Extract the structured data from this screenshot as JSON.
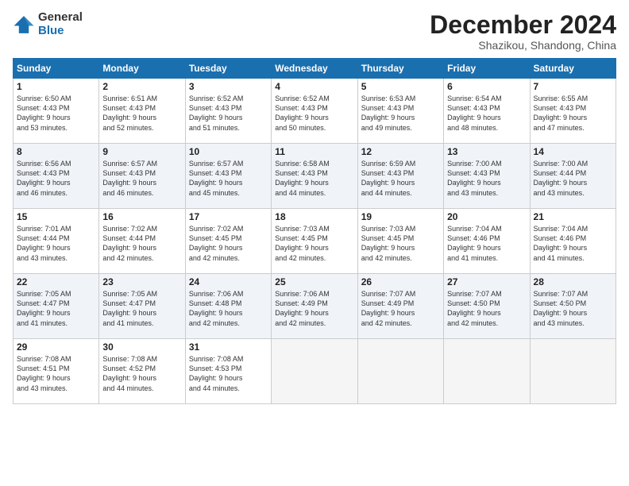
{
  "header": {
    "logo_general": "General",
    "logo_blue": "Blue",
    "month_title": "December 2024",
    "subtitle": "Shazikou, Shandong, China"
  },
  "weekdays": [
    "Sunday",
    "Monday",
    "Tuesday",
    "Wednesday",
    "Thursday",
    "Friday",
    "Saturday"
  ],
  "weeks": [
    [
      {
        "day": 1,
        "sunrise": "6:50 AM",
        "sunset": "4:43 PM",
        "daylight": "9 hours and 53 minutes."
      },
      {
        "day": 2,
        "sunrise": "6:51 AM",
        "sunset": "4:43 PM",
        "daylight": "9 hours and 52 minutes."
      },
      {
        "day": 3,
        "sunrise": "6:52 AM",
        "sunset": "4:43 PM",
        "daylight": "9 hours and 51 minutes."
      },
      {
        "day": 4,
        "sunrise": "6:52 AM",
        "sunset": "4:43 PM",
        "daylight": "9 hours and 50 minutes."
      },
      {
        "day": 5,
        "sunrise": "6:53 AM",
        "sunset": "4:43 PM",
        "daylight": "9 hours and 49 minutes."
      },
      {
        "day": 6,
        "sunrise": "6:54 AM",
        "sunset": "4:43 PM",
        "daylight": "9 hours and 48 minutes."
      },
      {
        "day": 7,
        "sunrise": "6:55 AM",
        "sunset": "4:43 PM",
        "daylight": "9 hours and 47 minutes."
      }
    ],
    [
      {
        "day": 8,
        "sunrise": "6:56 AM",
        "sunset": "4:43 PM",
        "daylight": "9 hours and 46 minutes."
      },
      {
        "day": 9,
        "sunrise": "6:57 AM",
        "sunset": "4:43 PM",
        "daylight": "9 hours and 46 minutes."
      },
      {
        "day": 10,
        "sunrise": "6:57 AM",
        "sunset": "4:43 PM",
        "daylight": "9 hours and 45 minutes."
      },
      {
        "day": 11,
        "sunrise": "6:58 AM",
        "sunset": "4:43 PM",
        "daylight": "9 hours and 44 minutes."
      },
      {
        "day": 12,
        "sunrise": "6:59 AM",
        "sunset": "4:43 PM",
        "daylight": "9 hours and 44 minutes."
      },
      {
        "day": 13,
        "sunrise": "7:00 AM",
        "sunset": "4:43 PM",
        "daylight": "9 hours and 43 minutes."
      },
      {
        "day": 14,
        "sunrise": "7:00 AM",
        "sunset": "4:44 PM",
        "daylight": "9 hours and 43 minutes."
      }
    ],
    [
      {
        "day": 15,
        "sunrise": "7:01 AM",
        "sunset": "4:44 PM",
        "daylight": "9 hours and 43 minutes."
      },
      {
        "day": 16,
        "sunrise": "7:02 AM",
        "sunset": "4:44 PM",
        "daylight": "9 hours and 42 minutes."
      },
      {
        "day": 17,
        "sunrise": "7:02 AM",
        "sunset": "4:45 PM",
        "daylight": "9 hours and 42 minutes."
      },
      {
        "day": 18,
        "sunrise": "7:03 AM",
        "sunset": "4:45 PM",
        "daylight": "9 hours and 42 minutes."
      },
      {
        "day": 19,
        "sunrise": "7:03 AM",
        "sunset": "4:45 PM",
        "daylight": "9 hours and 42 minutes."
      },
      {
        "day": 20,
        "sunrise": "7:04 AM",
        "sunset": "4:46 PM",
        "daylight": "9 hours and 41 minutes."
      },
      {
        "day": 21,
        "sunrise": "7:04 AM",
        "sunset": "4:46 PM",
        "daylight": "9 hours and 41 minutes."
      }
    ],
    [
      {
        "day": 22,
        "sunrise": "7:05 AM",
        "sunset": "4:47 PM",
        "daylight": "9 hours and 41 minutes."
      },
      {
        "day": 23,
        "sunrise": "7:05 AM",
        "sunset": "4:47 PM",
        "daylight": "9 hours and 41 minutes."
      },
      {
        "day": 24,
        "sunrise": "7:06 AM",
        "sunset": "4:48 PM",
        "daylight": "9 hours and 42 minutes."
      },
      {
        "day": 25,
        "sunrise": "7:06 AM",
        "sunset": "4:49 PM",
        "daylight": "9 hours and 42 minutes."
      },
      {
        "day": 26,
        "sunrise": "7:07 AM",
        "sunset": "4:49 PM",
        "daylight": "9 hours and 42 minutes."
      },
      {
        "day": 27,
        "sunrise": "7:07 AM",
        "sunset": "4:50 PM",
        "daylight": "9 hours and 42 minutes."
      },
      {
        "day": 28,
        "sunrise": "7:07 AM",
        "sunset": "4:50 PM",
        "daylight": "9 hours and 43 minutes."
      }
    ],
    [
      {
        "day": 29,
        "sunrise": "7:08 AM",
        "sunset": "4:51 PM",
        "daylight": "9 hours and 43 minutes."
      },
      {
        "day": 30,
        "sunrise": "7:08 AM",
        "sunset": "4:52 PM",
        "daylight": "9 hours and 44 minutes."
      },
      {
        "day": 31,
        "sunrise": "7:08 AM",
        "sunset": "4:53 PM",
        "daylight": "9 hours and 44 minutes."
      },
      null,
      null,
      null,
      null
    ]
  ]
}
